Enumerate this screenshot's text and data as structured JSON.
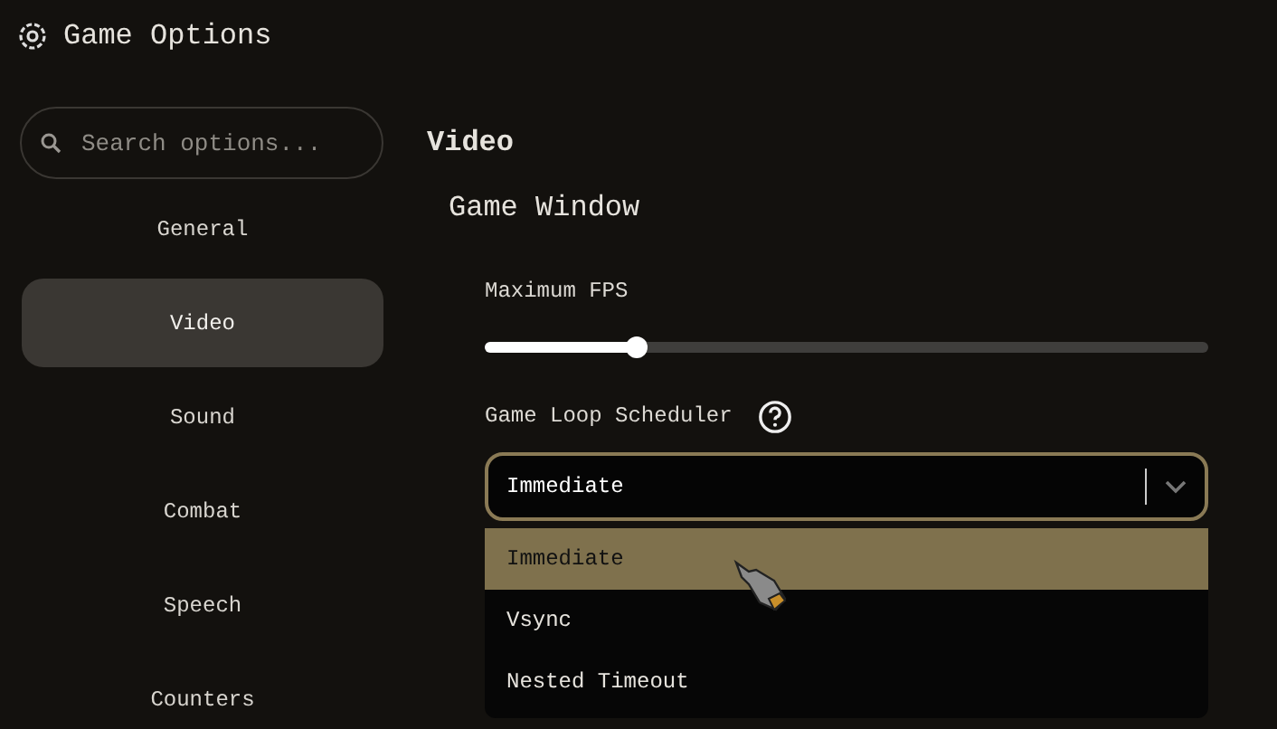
{
  "window": {
    "title": "Game Options"
  },
  "search": {
    "placeholder": "Search options..."
  },
  "sidebar": {
    "items": [
      {
        "label": "General",
        "selected": false
      },
      {
        "label": "Video",
        "selected": true
      },
      {
        "label": "Sound",
        "selected": false
      },
      {
        "label": "Combat",
        "selected": false
      },
      {
        "label": "Speech",
        "selected": false
      },
      {
        "label": "Counters",
        "selected": false
      }
    ]
  },
  "section": {
    "title": "Video",
    "group": "Game Window",
    "settings": [
      {
        "kind": "slider",
        "label": "Maximum FPS",
        "level": 0.21
      },
      {
        "kind": "select",
        "label": "Game Loop Scheduler",
        "help": true,
        "value": "Immediate",
        "expanded": true,
        "options": [
          {
            "label": "Immediate",
            "selected": true
          },
          {
            "label": "Vsync",
            "selected": false
          },
          {
            "label": "Nested Timeout",
            "selected": false
          }
        ]
      }
    ]
  }
}
